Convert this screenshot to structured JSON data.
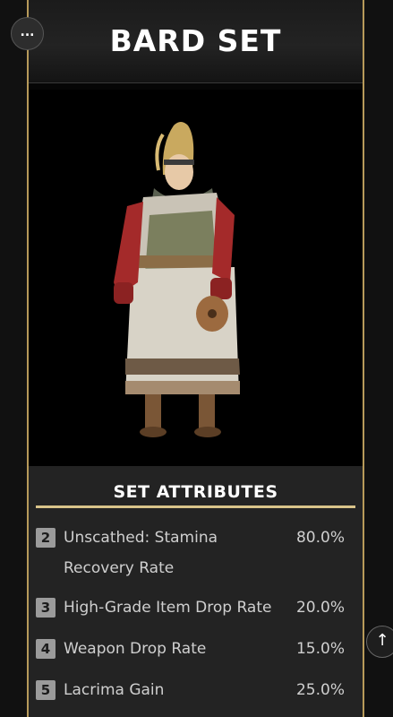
{
  "header": {
    "title": "BARD SET"
  },
  "menu_button": {
    "label": "...",
    "icon": "more-icon"
  },
  "scroll_top_button": {
    "label": "↑",
    "icon": "arrow-up-icon"
  },
  "accent_color": "#d8c38a",
  "attributes": {
    "title": "SET ATTRIBUTES",
    "rows": [
      {
        "pieces": "2",
        "label": "Unscathed: Stamina Recovery Rate",
        "value": "80.0%"
      },
      {
        "pieces": "3",
        "label": "High-Grade Item Drop Rate",
        "value": "20.0%"
      },
      {
        "pieces": "4",
        "label": "Weapon Drop Rate",
        "value": "15.0%"
      },
      {
        "pieces": "5",
        "label": "Lacrima Gain",
        "value": "25.0%"
      }
    ]
  }
}
